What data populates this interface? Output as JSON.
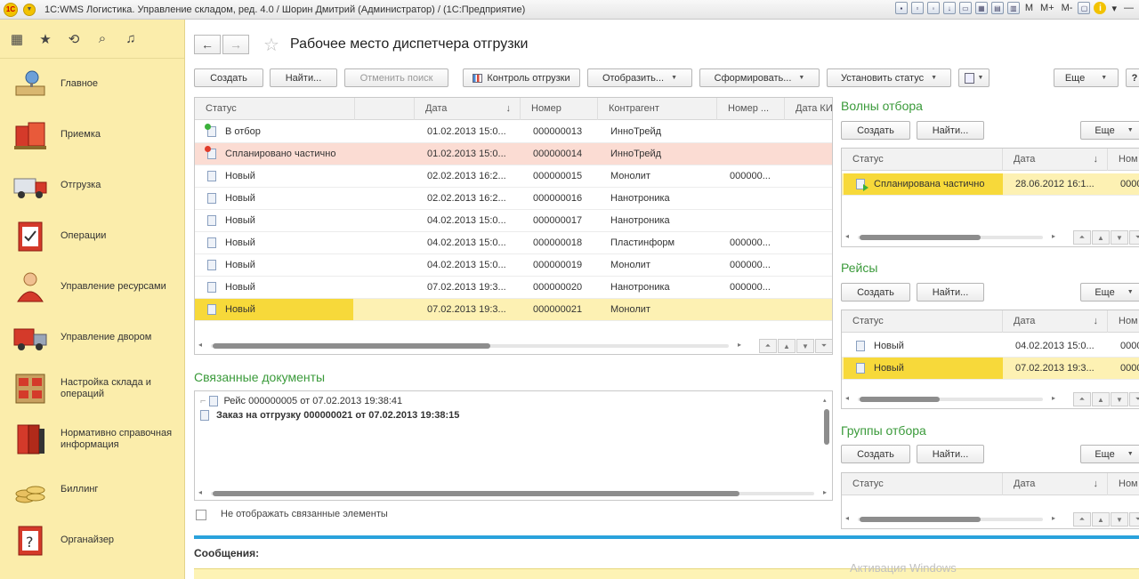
{
  "window": {
    "title": "1С:WMS Логистика. Управление складом, ред. 4.0 / Шорин Дмитрий (Администратор) /  (1С:Предприятие)",
    "memory_labels": [
      "M",
      "M+",
      "M-"
    ],
    "info": "i"
  },
  "sidebar": {
    "items": [
      {
        "label": "Главное"
      },
      {
        "label": "Приемка"
      },
      {
        "label": "Отгрузка"
      },
      {
        "label": "Операции"
      },
      {
        "label": "Управление ресурсами"
      },
      {
        "label": "Управление двором"
      },
      {
        "label": "Настройка склада и операций"
      },
      {
        "label": "Нормативно справочная информация"
      },
      {
        "label": "Биллинг"
      },
      {
        "label": "Органайзер"
      }
    ]
  },
  "header": {
    "back": "←",
    "forward": "→",
    "title": "Рабочее место диспетчера отгрузки"
  },
  "toolbar": {
    "create": "Создать",
    "find": "Найти...",
    "cancel_search": "Отменить поиск",
    "shipment_control": "Контроль отгрузки",
    "display": "Отобразить...",
    "form": "Сформировать...",
    "set_status": "Установить статус",
    "more": "Еще",
    "help": "?"
  },
  "orders": {
    "columns": [
      "Статус",
      "Дата",
      "Номер",
      "Контрагент",
      "Номер ...",
      "Дата КИ"
    ],
    "rows": [
      {
        "status": "В отбор",
        "date": "01.02.2013 15:0...",
        "number": "000000013",
        "partner": "ИнноТрейд",
        "num2": ""
      },
      {
        "status": "Спланировано частично",
        "date": "01.02.2013 15:0...",
        "number": "000000014",
        "partner": "ИнноТрейд",
        "num2": ""
      },
      {
        "status": "Новый",
        "date": "02.02.2013 16:2...",
        "number": "000000015",
        "partner": "Монолит",
        "num2": "000000..."
      },
      {
        "status": "Новый",
        "date": "02.02.2013 16:2...",
        "number": "000000016",
        "partner": "Нанотроника",
        "num2": ""
      },
      {
        "status": "Новый",
        "date": "04.02.2013 15:0...",
        "number": "000000017",
        "partner": "Нанотроника",
        "num2": ""
      },
      {
        "status": "Новый",
        "date": "04.02.2013 15:0...",
        "number": "000000018",
        "partner": "Пластинформ",
        "num2": "000000..."
      },
      {
        "status": "Новый",
        "date": "04.02.2013 15:0...",
        "number": "000000019",
        "partner": "Монолит",
        "num2": "000000..."
      },
      {
        "status": "Новый",
        "date": "07.02.2013 19:3...",
        "number": "000000020",
        "partner": "Нанотроника",
        "num2": "000000..."
      },
      {
        "status": "Новый",
        "date": "07.02.2013 19:3...",
        "number": "000000021",
        "partner": "Монолит",
        "num2": ""
      }
    ]
  },
  "related": {
    "title": "Связанные документы",
    "items": [
      "Рейс 000000005 от 07.02.2013 19:38:41",
      "Заказ на отгрузку 000000021 от 07.02.2013 19:38:15"
    ],
    "hide_label": "Не отображать связанные элементы"
  },
  "waves": {
    "title": "Волны отбора",
    "create": "Создать",
    "find": "Найти...",
    "more": "Еще",
    "columns": [
      "Статус",
      "Дата",
      "Ном"
    ],
    "rows": [
      {
        "status": "Спланирована частично",
        "date": "28.06.2012 16:1...",
        "number": "0000"
      }
    ]
  },
  "trips": {
    "title": "Рейсы",
    "create": "Создать",
    "find": "Найти...",
    "more": "Еще",
    "columns": [
      "Статус",
      "Дата",
      "Ном"
    ],
    "rows": [
      {
        "status": "Новый",
        "date": "04.02.2013 15:0...",
        "number": "0000"
      },
      {
        "status": "Новый",
        "date": "07.02.2013 19:3...",
        "number": "0000"
      }
    ]
  },
  "groups": {
    "title": "Группы отбора",
    "create": "Создать",
    "find": "Найти...",
    "more": "Еще",
    "columns": [
      "Статус",
      "Дата",
      "Ном"
    ]
  },
  "messages": {
    "label": "Сообщения:"
  },
  "watermark": "Активация Windows",
  "colors": {
    "sidebar_bg": "#fbedab",
    "accent_green": "#3a9a3a",
    "selected_row": "#fdf1b3",
    "highlight_cell": "#f7d93a",
    "pink_row": "#fbdcd3",
    "message_line": "#2aa2dc"
  }
}
